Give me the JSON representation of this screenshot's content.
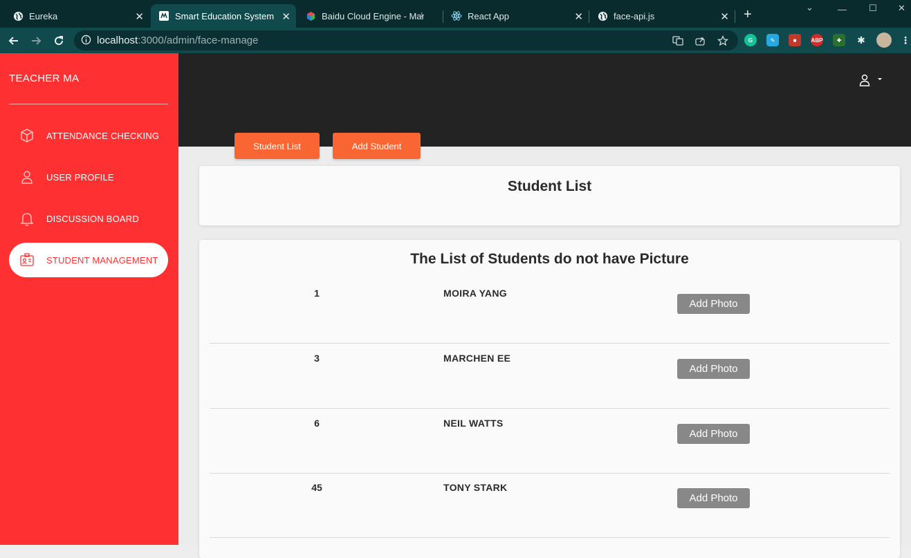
{
  "browser": {
    "tabs": [
      {
        "label": "Eureka",
        "icon": "globe-icon"
      },
      {
        "label": "Smart Education System",
        "icon": "app-favicon-icon"
      },
      {
        "label": "Baidu Cloud Engine - Mar",
        "icon": "baidu-cloud-icon"
      },
      {
        "label": "React App",
        "icon": "react-icon"
      },
      {
        "label": "face-api.js",
        "icon": "globe-icon"
      }
    ],
    "active_tab": 1,
    "url_host": "localhost",
    "url_rest": ":3000/admin/face-manage"
  },
  "sidebar": {
    "brand": "TEACHER MA",
    "items": [
      {
        "label": "ATTENDANCE CHECKING",
        "icon": "cube-icon"
      },
      {
        "label": "USER PROFILE",
        "icon": "user-icon"
      },
      {
        "label": "DISCUSSION BOARD",
        "icon": "bell-icon"
      },
      {
        "label": "STUDENT MANAGEMENT",
        "icon": "id-card-icon"
      }
    ],
    "active_index": 3
  },
  "main": {
    "buttons": {
      "student_list": "Student List",
      "add_student": "Add Student"
    },
    "card_title": "Student List",
    "list_title": "The List of Students do not have Picture",
    "rows": [
      {
        "id": "1",
        "name": "MOIRA YANG",
        "action": "Add Photo"
      },
      {
        "id": "3",
        "name": "MARCHEN EE",
        "action": "Add Photo"
      },
      {
        "id": "6",
        "name": "NEIL WATTS",
        "action": "Add Photo"
      },
      {
        "id": "45",
        "name": "TONY STARK",
        "action": "Add Photo"
      }
    ]
  },
  "colors": {
    "sidebar": "#fe3031",
    "accent_button": "#f96533",
    "add_photo_button": "#888888",
    "hero": "#232323"
  }
}
